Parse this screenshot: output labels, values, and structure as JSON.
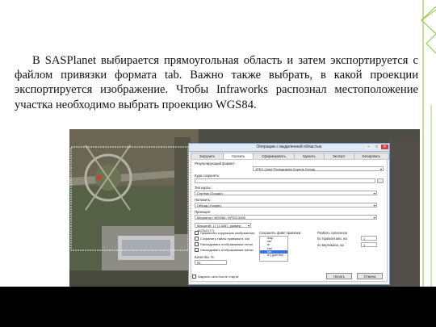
{
  "slide": {
    "paragraph": "В SASPlanet выбирается прямоугольная область и затем экспортируется с файлом привязки формата tab. Важно также выбрать, в какой проекции экспортируется изображение. Чтобы Infraworks распознал местоположение участка необходимо выбрать проекцию WGS84.",
    "accent_color": "#8dc63f"
  },
  "dialog": {
    "title": "Операции с выделенной областью",
    "tabs": [
      "Загрузить",
      "Склеить",
      "Сформировать",
      "Удалить",
      "Экспорт",
      "Копировать"
    ],
    "active_tab": "Склеить",
    "result_format_label": "Результирующий формат:",
    "result_format_value": "JPEG (Joint Photographic Experts Group)",
    "save_to_label": "Куда сохранять:",
    "save_to_value": "",
    "map_type_label": "Тип карты:",
    "map_type_value": "Спутник (Google)",
    "overlay_label": "Наложить:",
    "overlay_value": "Гибрид (Google)",
    "projection_label": "Проекция:",
    "projection_value": "Меркатор / WGS84 / EPSG:3395",
    "scale_label": "Масштаб: 17 (1:4267, размер: 4670x2177)",
    "options": [
      "Применить коррекцию изображения",
      "Сохранять тайлы привязки в .kal",
      "Накладывать отображаемые сетки",
      "Накладывать отображаемые метки"
    ],
    "quality_label": "Качество, %:",
    "quality_value": "95",
    "save_georef_label": "Сохранять файл привязки:",
    "georef_formats": [
      ".map",
      ".tab",
      ".w",
      ".kml",
      ".tab",
      ".w (.jpw/.tfw)"
    ],
    "georef_selected_index": 4,
    "split_label": "Разбить склеенное",
    "split_horizontal_label": "по горизонтали, на",
    "split_horizontal_value": "1",
    "split_vertical_label": "по вертикали, на",
    "split_vertical_value": "1",
    "close_after_label": "Закрыть окно после старта",
    "start_label": "Начать",
    "cancel_label": "Отмена"
  }
}
